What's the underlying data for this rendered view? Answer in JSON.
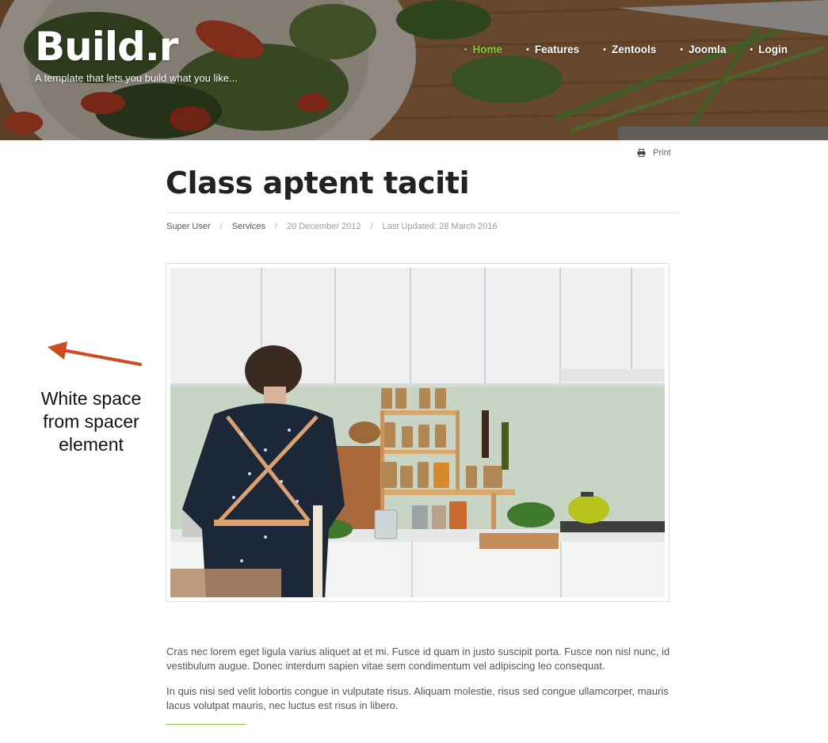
{
  "site": {
    "logo": "Build.r",
    "tagline": "A template that lets you build what you like..."
  },
  "nav": {
    "items": [
      {
        "label": "Home",
        "active": true
      },
      {
        "label": "Features",
        "active": false
      },
      {
        "label": "Zentools",
        "active": false
      },
      {
        "label": "Joomla",
        "active": false
      },
      {
        "label": "Login",
        "active": false
      }
    ],
    "bullet": "•",
    "active_color": "#8cc63f"
  },
  "article": {
    "print_label": "Print",
    "print_icon": "printer-icon",
    "title": "Class aptent taciti",
    "meta": {
      "author": "Super User",
      "category": "Services",
      "published": "20 December 2012",
      "updated": "Last Updated: 28 March 2016",
      "separator": "/"
    },
    "image_subject": "kitchen-photo",
    "paragraphs": [
      "Cras nec lorem eget ligula varius aliquet at et mi. Fusce id quam in justo suscipit porta. Fusce non nisl nunc, id vestibulum augue. Donec interdum sapien vitae sem condimentum vel adipiscing leo consequat.",
      "In quis nisi sed velit lobortis congue in vulputate risus. Aliquam molestie, risus sed congue ullamcorper, mauris lacus volutpat mauris, nec luctus est risus in libero."
    ]
  },
  "annotation": {
    "text": "White space from spacer element",
    "arrow_color": "#d04a1e"
  },
  "colors": {
    "accent": "#8cc63f",
    "title": "#222222",
    "body_text": "#555555",
    "annotation_arrow": "#d04a1e"
  }
}
